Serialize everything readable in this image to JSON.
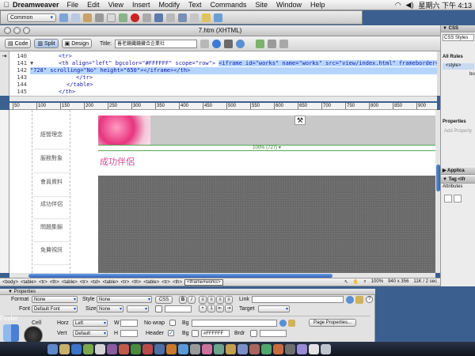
{
  "menubar": {
    "app": "Dreamweaver",
    "items": [
      "File",
      "Edit",
      "View",
      "Insert",
      "Modify",
      "Text",
      "Commands",
      "Site",
      "Window",
      "Help"
    ],
    "clock": "星期六 下午 4:13"
  },
  "insertbar": {
    "category": "Common"
  },
  "window": {
    "title": "7.htm (XHTML)"
  },
  "docbar": {
    "code": "Code",
    "split": "Split",
    "design": "Design",
    "title_label": "Title:",
    "title_value": "善老鏡纖鏡藏合企業社"
  },
  "code_lines": [
    {
      "num": "140",
      "text": "<tr>"
    },
    {
      "num": "141",
      "text_pre": "<th align=\"left\" bgcolor=\"#FFFFFF\" scope=\"row\">",
      "text_hl": "<iframe id=\"works\" name=\"works\" src=\"view/index.html\" frameborder=\"0\" width="
    },
    {
      "num": "142",
      "text_hl": "\"728\" scrolling=\"No\" height=\"650\"></iframe></th>"
    },
    {
      "num": "143",
      "text": "</tr>"
    },
    {
      "num": "144",
      "text": "</table>"
    },
    {
      "num": "145",
      "text": "</th>"
    }
  ],
  "ruler_ticks": [
    "50",
    "100",
    "150",
    "200",
    "250",
    "300",
    "350",
    "400",
    "450",
    "500",
    "550",
    "600",
    "650",
    "700",
    "750",
    "800",
    "850",
    "900"
  ],
  "nav_items": [
    "經營理念",
    "服務對象",
    "會員資料",
    "成功伴侶",
    "問題集錦",
    "免費視訊"
  ],
  "design": {
    "width_label": "100% (727) ▾",
    "partner_heading": "成功伴侶"
  },
  "status": {
    "crumbs": [
      "<body>",
      "<table>",
      "<tr>",
      "<th>",
      "<table>",
      "<tr>",
      "<td>",
      "<table>",
      "<tr>",
      "<th>",
      "<table>",
      "<tr>",
      "<th>"
    ],
    "selected": "<iframe#works>",
    "zoom": "100%",
    "size": "940 x 356",
    "weight": "11K / 2 sec"
  },
  "props": {
    "header": "▼ Properties",
    "format_label": "Format",
    "format_value": "None",
    "style_label": "Style",
    "style_value": "None",
    "css_btn": "CSS",
    "bold": "B",
    "italic": "I",
    "link_label": "Link",
    "font_label": "Font",
    "font_value": "Default Font",
    "size_label": "Size",
    "size_value": "None",
    "target_label": "Target",
    "cell_label": "Cell",
    "horz_label": "Horz",
    "horz_value": "Left",
    "w_label": "W",
    "nowrap_label": "No wrap",
    "bg_label": "Bg",
    "page_props": "Page Properties...",
    "vert_label": "Vert",
    "vert_value": "Default",
    "h_label": "H",
    "header_label": "Header",
    "bg2_label": "Bg",
    "bg2_value": "#FFFFFF",
    "brdr_label": "Brdr"
  },
  "rightpanel": {
    "css": "▼ CSS",
    "css_styles": "CSS Styles",
    "all_rules": "All Rules",
    "style_rule": "<style>",
    "bo": "bo",
    "properties": "Properties",
    "add_property": "Add Property",
    "applic": "▶ Applica",
    "tag": "▼ Tag <ifr",
    "attributes": "Attributes"
  },
  "dock": {
    "finder": "Finder"
  },
  "colors": {
    "accent": "#2f62b8",
    "highlight": "#b5d5ff",
    "partner": "#d64d91",
    "iframe": "#6a6a6a"
  }
}
